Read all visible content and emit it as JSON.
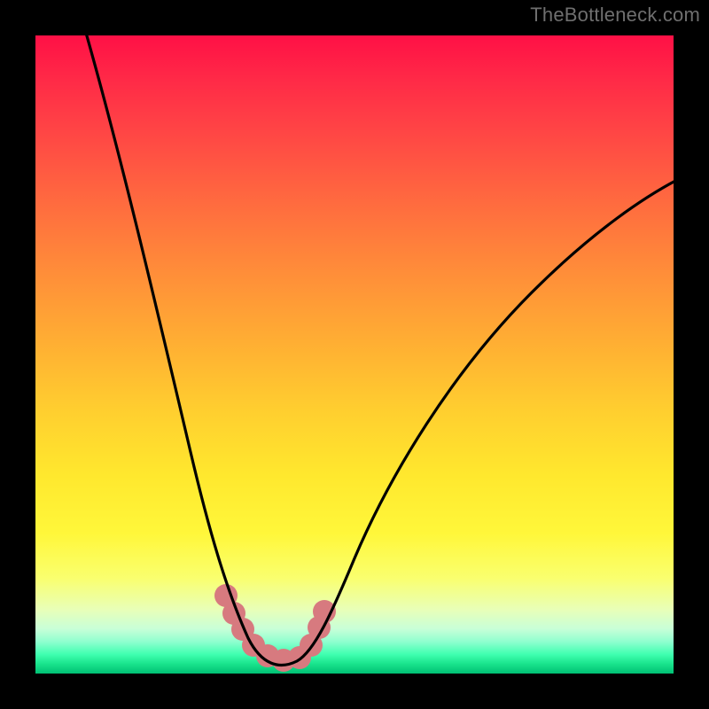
{
  "watermark": "TheBottleneck.com",
  "chart_data": {
    "type": "line",
    "title": "",
    "xlabel": "",
    "ylabel": "",
    "xlim": [
      0,
      100
    ],
    "ylim": [
      0,
      100
    ],
    "series": [
      {
        "name": "bottleneck-curve",
        "x": [
          7,
          10,
          14,
          18,
          22,
          25,
          28,
          30,
          32,
          34,
          36,
          38,
          40,
          44,
          50,
          58,
          66,
          74,
          82,
          90,
          100
        ],
        "y": [
          100,
          88,
          74,
          60,
          46,
          35,
          24,
          16,
          10,
          6,
          3,
          2,
          2,
          4,
          10,
          20,
          32,
          44,
          54,
          62,
          70
        ]
      }
    ],
    "markers": {
      "name": "highlight-segment",
      "x": [
        29,
        31,
        33,
        35,
        37,
        39,
        41,
        42
      ],
      "y": [
        15,
        9,
        5,
        3,
        2,
        2,
        4,
        10
      ]
    },
    "colors": {
      "curve": "#000000",
      "marker": "#d77a7f",
      "background_top": "#ff1a48",
      "background_bottom": "#00c074"
    }
  }
}
